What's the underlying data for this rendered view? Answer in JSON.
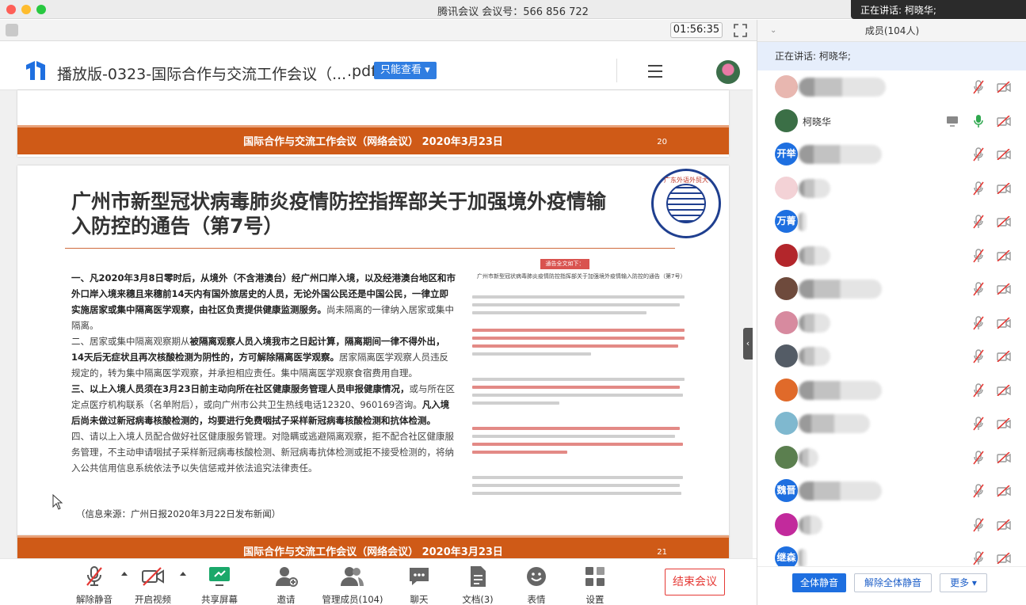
{
  "window": {
    "title": "腾讯会议 会议号：566 856 722",
    "speaking_toast": "正在讲话: 柯晓华;"
  },
  "toolbar": {
    "timer": "01:56:35"
  },
  "document": {
    "name": "播放版-0323-国际合作与交流工作会议（...",
    "ext": ".pdf",
    "mode_label": "只能查看",
    "band_text": "国际合作与交流工作会议（网络会议）  2020年3月23日",
    "page_prev_number": "20",
    "page_next_number": "21",
    "main_title": "广州市新型冠状病毒肺炎疫情防控指挥部关于加强境外疫情输入防控的通告（第7号）",
    "paragraphs": [
      {
        "lead": "一、凡2020年3月8日零时后，从境外（不含港澳台）经广州口岸入境，以及经港澳台地区和市外口岸入境来穗且来穗前14天内有国外旅居史的人员，无论外国公民还是中国公民，一律立即实施居家或集中隔离医学观察，由社区负责提供健康监测服务。",
        "rest": "尚未隔离的一律纳入居家或集中隔离。"
      },
      {
        "lead": "二、居家或集中隔离观察期从",
        "bold": "被隔离观察人员入境我市之日起计算，隔离期间一律不得外出，14天后无症状且再次核酸检测为阴性的，方可解除隔离医学观察。",
        "rest": "居家隔离医学观察人员违反规定的，转为集中隔离医学观察，并承担相应责任。集中隔离医学观察食宿费用自理。"
      },
      {
        "lead": "三、以上入境人员须在3月23日前主动向所在社区健康服务管理人员申报健康情况，",
        "rest": "或与所在区定点医疗机构联系（名单附后），或向广州市公共卫生热线电话12320、960169咨询。",
        "bold": "凡入境后尚未做过新冠病毒核酸检测的，均要进行免费咽拭子采样新冠病毒核酸检测和抗体检测。"
      },
      {
        "lead": "",
        "rest": "四、请以上入境人员配合做好社区健康服务管理。对隐瞒或逃避隔离观察，拒不配合社区健康服务管理，不主动申请咽拭子采样新冠病毒核酸检测、新冠病毒抗体检测或拒不接受检测的，将纳入公共信用信息系统依法予以失信惩戒并依法追究法律责任。"
      }
    ],
    "source": "（信息来源：广州日报2020年3月22日发布新闻）",
    "inset_tag": "通告全文如下：",
    "inset_title": "广州市新型冠状病毒肺炎疫情防控指挥部关于加强境外疫情输入防控的通告（第7号）",
    "seal_text": "广东外语外贸大学"
  },
  "controls": [
    {
      "label": "解除静音",
      "icon": "mic-muted-icon"
    },
    {
      "label": "开启视频",
      "icon": "video-off-icon"
    },
    {
      "label": "共享屏幕",
      "icon": "share-screen-icon"
    },
    {
      "label": "邀请",
      "icon": "invite-icon"
    },
    {
      "label": "管理成员(104)",
      "icon": "members-icon"
    },
    {
      "label": "聊天",
      "icon": "chat-icon"
    },
    {
      "label": "文档(3)",
      "icon": "document-icon"
    },
    {
      "label": "表情",
      "icon": "emoji-icon"
    },
    {
      "label": "设置",
      "icon": "settings-icon"
    }
  ],
  "end_meeting": "结束会议",
  "sidebar": {
    "header": "成员(104人)",
    "speaking": "正在讲话: 柯晓华;",
    "members": [
      {
        "name": "",
        "avatar_text": "",
        "avatar_color": "#e8b7b0"
      },
      {
        "name": "柯晓华",
        "avatar_text": "",
        "avatar_color": "#3b6f46"
      },
      {
        "name": "",
        "avatar_text": "开举",
        "avatar_color": "#1e6fe0"
      },
      {
        "name": "",
        "avatar_text": "",
        "avatar_color": "#f3d2d6"
      },
      {
        "name": "",
        "avatar_text": "万菁",
        "avatar_color": "#1e6fe0"
      },
      {
        "name": "",
        "avatar_text": "",
        "avatar_color": "#b3262b"
      },
      {
        "name": "",
        "avatar_text": "",
        "avatar_color": "#6e4a3c"
      },
      {
        "name": "",
        "avatar_text": "",
        "avatar_color": "#d78a9f"
      },
      {
        "name": "",
        "avatar_text": "",
        "avatar_color": "#545c66"
      },
      {
        "name": "",
        "avatar_text": "",
        "avatar_color": "#e06a2a"
      },
      {
        "name": "",
        "avatar_text": "",
        "avatar_color": "#7fb8cf"
      },
      {
        "name": "",
        "avatar_text": "",
        "avatar_color": "#5b7f4f"
      },
      {
        "name": "",
        "avatar_text": "魏晋",
        "avatar_color": "#1e6fe0"
      },
      {
        "name": "",
        "avatar_text": "",
        "avatar_color": "#c22a9c"
      },
      {
        "name": "",
        "avatar_text": "继森",
        "avatar_color": "#1e6fe0"
      }
    ],
    "mute_all": "全体静音",
    "unmute_all": "解除全体静音",
    "more": "更多"
  }
}
